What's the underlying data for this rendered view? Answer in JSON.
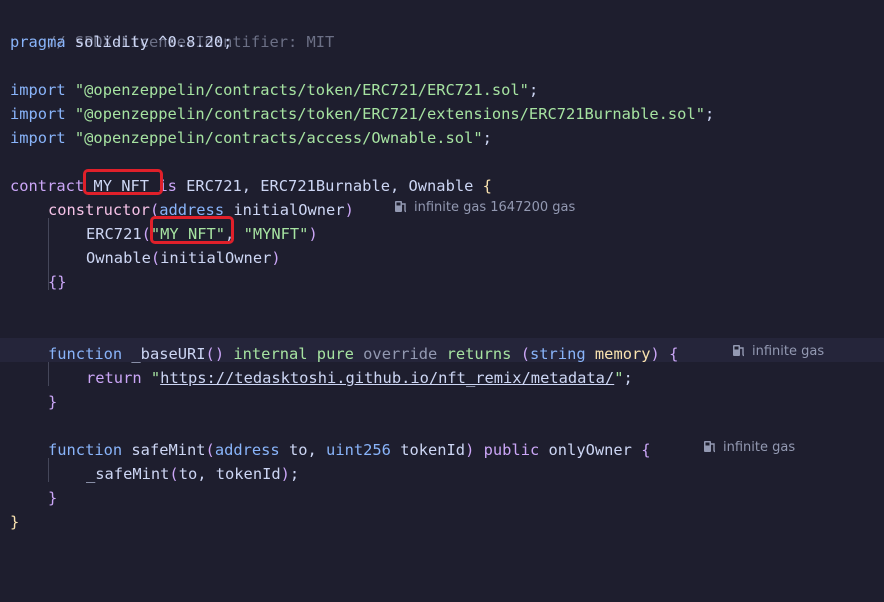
{
  "code": {
    "l1": "// SPDX-License-Identifier: MIT",
    "l2_kw": "pragma",
    "l2_rest": " solidity ^0.8.20;",
    "import_kw": "import",
    "imp1": "\"@openzeppelin/contracts/token/ERC721/ERC721.sol\"",
    "imp2": "\"@openzeppelin/contracts/token/ERC721/extensions/ERC721Burnable.sol\"",
    "imp3": "\"@openzeppelin/contracts/access/Ownable.sol\"",
    "semi": ";",
    "contract_kw": "contract",
    "contract_name": "MY_NFT",
    "is_kw": "is",
    "contract_bases": " ERC721, ERC721Burnable, Ownable ",
    "brace_open": "{",
    "brace_close": "}",
    "ctor_kw": "constructor",
    "ctor_paren_open": "(",
    "ctor_type": "address",
    "ctor_param": " initialOwner",
    "ctor_paren_close": ")",
    "erc_call": "ERC721",
    "erc_name_arg": "\"MY_NFT\"",
    "erc_comma": ", ",
    "erc_symbol_arg": "\"MYNFT\"",
    "ownable_call": "Ownable",
    "ownable_arg": "initialOwner",
    "empty_body": "{}",
    "fn_kw": "function",
    "fn1_name": " _baseURI",
    "fn1_internal": "internal",
    "fn1_pure": "pure",
    "fn1_override": "override",
    "fn1_returns": "returns",
    "fn1_string": "string",
    "fn1_memory": "memory",
    "return_kw": "return",
    "return_url": "https://tedasktoshi.github.io/nft_remix/metadata/",
    "fn2_name": " safeMint",
    "fn2_type1": "address",
    "fn2_p1": " to, ",
    "fn2_type2": "uint256",
    "fn2_p2": " tokenId",
    "fn2_public": "public",
    "fn2_onlyowner": "onlyOwner",
    "safemint_call": "_safeMint",
    "safemint_args": "to, tokenId"
  },
  "gas": {
    "ctor": "infinite gas 1647200 gas",
    "baseuri": "infinite gas",
    "safemint": "infinite gas"
  },
  "icons": [
    "gas-pump-icon"
  ]
}
